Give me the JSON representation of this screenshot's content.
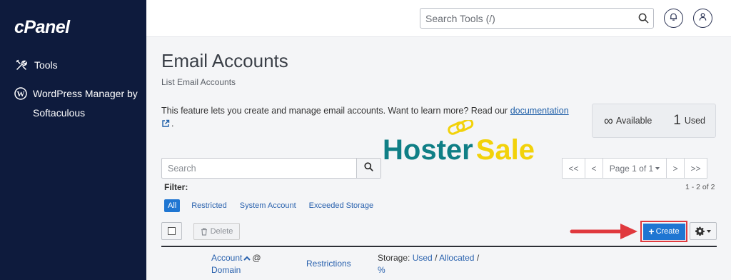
{
  "sidebar": {
    "logo": "cPanel",
    "items": [
      {
        "label": "Tools",
        "icon": "tools-icon"
      },
      {
        "label": "WordPress Manager by Softaculous",
        "icon": "wordpress-icon"
      }
    ]
  },
  "topbar": {
    "search_placeholder": "Search Tools (/)"
  },
  "page": {
    "title": "Email Accounts",
    "subtitle": "List Email Accounts",
    "intro_text": "This feature lets you create and manage email accounts. Want to learn more? Read our ",
    "intro_link": "documentation",
    "intro_end": "."
  },
  "stats": {
    "available_symbol": "∞",
    "available_label": "Available",
    "used_count": "1",
    "used_label": "Used"
  },
  "watermark": {
    "text_part1": "Hoster",
    "text_part2": "Sale"
  },
  "list": {
    "search_placeholder": "Search",
    "pager": {
      "first": "<<",
      "prev": "<",
      "page": "Page 1 of 1",
      "next": ">",
      "last": ">>"
    },
    "filter_label": "Filter:",
    "range": "1 - 2 of 2",
    "filters": [
      "All",
      "Restricted",
      "System Account",
      "Exceeded Storage"
    ],
    "delete_label": "Delete",
    "create_label": "Create",
    "columns": {
      "account": "Account",
      "at": "@",
      "domain": "Domain",
      "restrictions": "Restrictions",
      "storage_prefix": "Storage:",
      "used": "Used",
      "slash1": "/",
      "allocated": "Allocated",
      "slash2": "/",
      "percent": "%"
    }
  },
  "colors": {
    "sidebar_bg": "#0e1b3d",
    "primary": "#1f76d2",
    "highlight": "#e0393e",
    "watermark_teal": "#0f7f86",
    "watermark_yellow": "#f2d20a"
  }
}
